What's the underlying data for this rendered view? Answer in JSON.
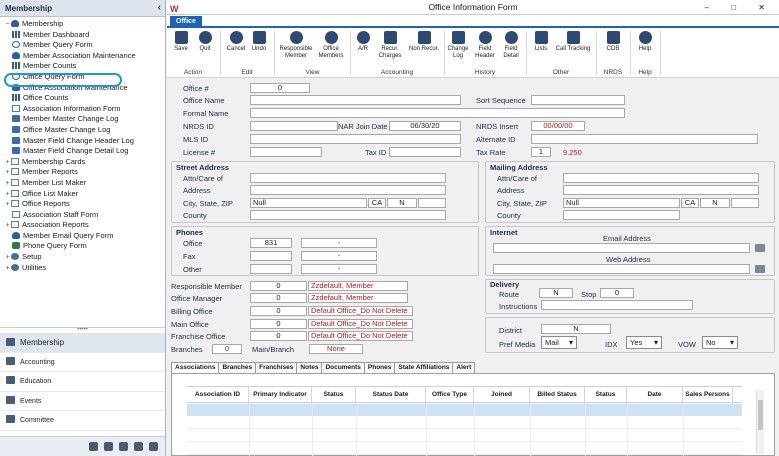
{
  "sidebar": {
    "title": "Membership",
    "collapse_glyph": "‹",
    "root": "Membership",
    "items": [
      {
        "label": "Member Dashboard",
        "icon": "bars"
      },
      {
        "label": "Member Query Form",
        "icon": "search"
      },
      {
        "label": "Member Association Maintenance",
        "icon": "person"
      },
      {
        "label": "Member Counts",
        "icon": "bars"
      },
      {
        "label": "Office Query Form",
        "icon": "search"
      },
      {
        "label": "Office Association Maintenance",
        "icon": "person"
      },
      {
        "label": "Office Counts",
        "icon": "bars"
      },
      {
        "label": "Association Information Form",
        "icon": "doc"
      },
      {
        "label": "Member Master Change Log",
        "icon": "log"
      },
      {
        "label": "Office Master Change Log",
        "icon": "log"
      },
      {
        "label": "Master Field Change Header Log",
        "icon": "log"
      },
      {
        "label": "Master Field Change Detail Log",
        "icon": "log"
      }
    ],
    "groups": [
      {
        "label": "Membership Cards",
        "icon": "doc"
      },
      {
        "label": "Member Reports",
        "icon": "doc"
      },
      {
        "label": "Member List Maker",
        "icon": "doc"
      },
      {
        "label": "Office List Maker",
        "icon": "doc"
      },
      {
        "label": "Office Reports",
        "icon": "doc"
      }
    ],
    "items2": [
      {
        "label": "Association Staff Form",
        "icon": "doc"
      }
    ],
    "groups2": [
      {
        "label": "Association Reports",
        "icon": "doc"
      }
    ],
    "items3": [
      {
        "label": "Member Email Query Form",
        "icon": "person"
      },
      {
        "label": "Phone Query Form",
        "icon": "phone"
      }
    ],
    "groups3": [
      {
        "label": "Setup",
        "icon": "gear"
      },
      {
        "label": "Utilities",
        "icon": "gear"
      }
    ],
    "modules": [
      "Membership",
      "Accounting",
      "Education",
      "Events",
      "Committee"
    ],
    "splitter_glyph": "•••••",
    "highlight_color": "#1b9ad6"
  },
  "window": {
    "title": "Office Information Form",
    "logo": "W",
    "controls": "‒ □ ✕",
    "tab": "Office"
  },
  "ribbon": {
    "buttons": {
      "save": "Save",
      "quit": "Quit",
      "cancel": "Cancel",
      "undo": "Undo",
      "resp_member": "Responsible Member",
      "office_members": "Office Members",
      "ar": "A/R",
      "recur_charges": "Recur. Charges",
      "non_recur": "Non Recur.",
      "change_log": "Change Log",
      "field_header": "Field Header",
      "field_detail": "Field Detail",
      "lists": "Lists",
      "call_tracking": "Call Tracking",
      "cdb": "CDB",
      "help": "Help"
    },
    "groups": {
      "action": "Action",
      "edit": "Edit",
      "view": "View",
      "accounting": "Accounting",
      "history": "History",
      "other": "Other",
      "nrds": "NRDS",
      "help": "Help"
    }
  },
  "form": {
    "office_no_label": "Office #",
    "office_no": "0",
    "office_name_label": "Office Name",
    "office_name": "",
    "sort_seq_label": "Sort Sequence",
    "sort_seq": "",
    "formal_name_label": "Formal Name",
    "formal_name": "",
    "nrds_id_label": "NRDS ID",
    "nrds_id": "",
    "nar_join_label": "NAR Join Date",
    "nar_join": "06/30/20",
    "nrds_insert_label": "NRDS Insert",
    "nrds_insert": "00/00/00",
    "mls_id_label": "MLS ID",
    "mls_id": "",
    "alt_id_label": "Alternate ID",
    "alt_id": "",
    "license_label": "License #",
    "license": "",
    "tax_id_label": "Tax ID",
    "tax_id": "",
    "tax_rate_label": "Tax Rate",
    "tax_rate_code": "1",
    "tax_rate": "9.250",
    "street": {
      "title": "Street Address",
      "attn_label": "Attn/Care of",
      "address_label": "Address",
      "csz_label": "City, State, ZIP",
      "city": "Null",
      "state": "CA",
      "zip": "N",
      "county_label": "County"
    },
    "mailing": {
      "title": "Mailing Address",
      "attn_label": "Attn/Care of",
      "address_label": "Address",
      "csz_label": "City, State, ZIP",
      "city": "Null",
      "state": "CA",
      "zip": "N",
      "county_label": "County"
    },
    "phones": {
      "title": "Phones",
      "office_label": "Office",
      "office_area": "831",
      "office_num": "-",
      "fax_label": "Fax",
      "fax_num": "-",
      "other_label": "Other",
      "other_num": "-"
    },
    "internet": {
      "title": "Internet",
      "email_label": "Email Address",
      "web_label": "Web Address"
    },
    "responsible": {
      "label": "Responsible Member",
      "id": "0",
      "name": "Zzdefault, Member"
    },
    "manager": {
      "label": "Office Manager",
      "id": "0",
      "name": "Zzdefault, Member"
    },
    "billing": {
      "label": "Billing Office",
      "id": "0",
      "name": "Default Office_Do Not Delete"
    },
    "main_office": {
      "label": "Main Office",
      "id": "0",
      "name": "Default Office_Do Not Delete"
    },
    "franchise": {
      "label": "Franchise Office",
      "id": "0",
      "name": "Default Office_Do Not Delete"
    },
    "branches_label": "Branches",
    "branches": "0",
    "main_branch_label": "Main/Branch",
    "main_branch": "None",
    "delivery": {
      "title": "Delivery",
      "route_label": "Route",
      "route": "N",
      "stop_label": "Stop",
      "stop": "0",
      "instructions_label": "Instructions"
    },
    "district_label": "District",
    "district": "N",
    "pref_media_label": "Pref Media",
    "pref_media": "Mail",
    "idx_label": "IDX",
    "idx": "Yes",
    "vow_label": "VOW",
    "vow": "No"
  },
  "bottom_tabs": [
    "Associations",
    "Branches",
    "Franchises",
    "Notes",
    "Documents",
    "Phones",
    "State Affiliations",
    "Alert"
  ],
  "grid": {
    "columns": [
      "Association ID",
      "Primary Indicator",
      "Status",
      "Status Date",
      "Office Type",
      "Joined",
      "Billed Status",
      "Status",
      "Date",
      "Sales Persons"
    ]
  }
}
